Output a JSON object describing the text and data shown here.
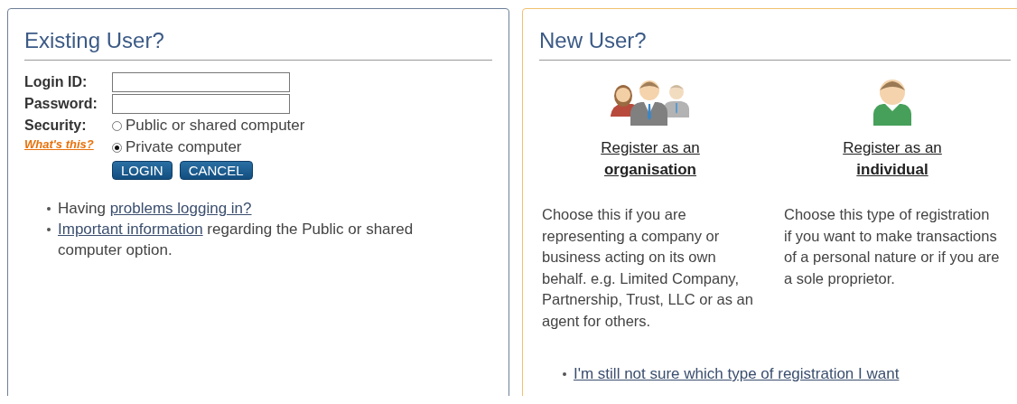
{
  "existing_user": {
    "title": "Existing User?",
    "fields": [
      {
        "label": "Login ID:"
      },
      {
        "label": "Password:"
      }
    ],
    "security": {
      "label": "Security:",
      "help_link": "What's this?",
      "options": [
        {
          "label": "Public or shared computer",
          "selected": false
        },
        {
          "label": "Private computer",
          "selected": true
        }
      ]
    },
    "buttons": [
      "LOGIN",
      "CANCEL"
    ],
    "help_items": [
      {
        "before": "Having ",
        "link": "problems logging in?"
      },
      {
        "link": "Important information",
        "after": " regarding the Public or shared computer option."
      }
    ]
  },
  "new_user": {
    "title": "New User?",
    "options": [
      {
        "kind": "group",
        "link": "Register as an **organisation**",
        "description": "Choose this if you are representing a company or business acting on its own behalf. e.g. Limited Company, Partnership, Trust, LLC or as an agent for others."
      },
      {
        "kind": "single",
        "link": "Register as an **individual**",
        "description": "Choose this type of registration if you want to make transactions of a personal nature or if you are a sole proprietor."
      }
    ],
    "help_link": "I'm still not sure which type of registration I want"
  }
}
